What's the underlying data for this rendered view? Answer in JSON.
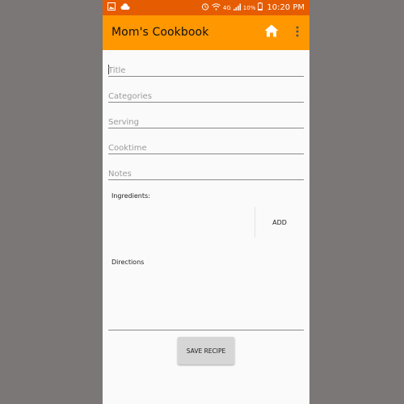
{
  "status_bar": {
    "signal_label": "4G",
    "battery": "10%",
    "time": "10:20 PM"
  },
  "app_bar": {
    "title": "Mom's Cookbook",
    "home_icon": "home-icon",
    "overflow_icon": "more-vert-icon"
  },
  "form": {
    "title_placeholder": "Title",
    "categories_placeholder": "Categories",
    "serving_placeholder": "Serving",
    "cooktime_placeholder": "Cooktime",
    "notes_placeholder": "Notes",
    "ingredients_label": "Ingredients:",
    "add_label": "ADD",
    "directions_label": "Directions",
    "save_label": "SAVE RECIPE"
  },
  "colors": {
    "status_bar": "#e65c00",
    "app_bar": "#ff9800",
    "background": "#fafafa"
  }
}
